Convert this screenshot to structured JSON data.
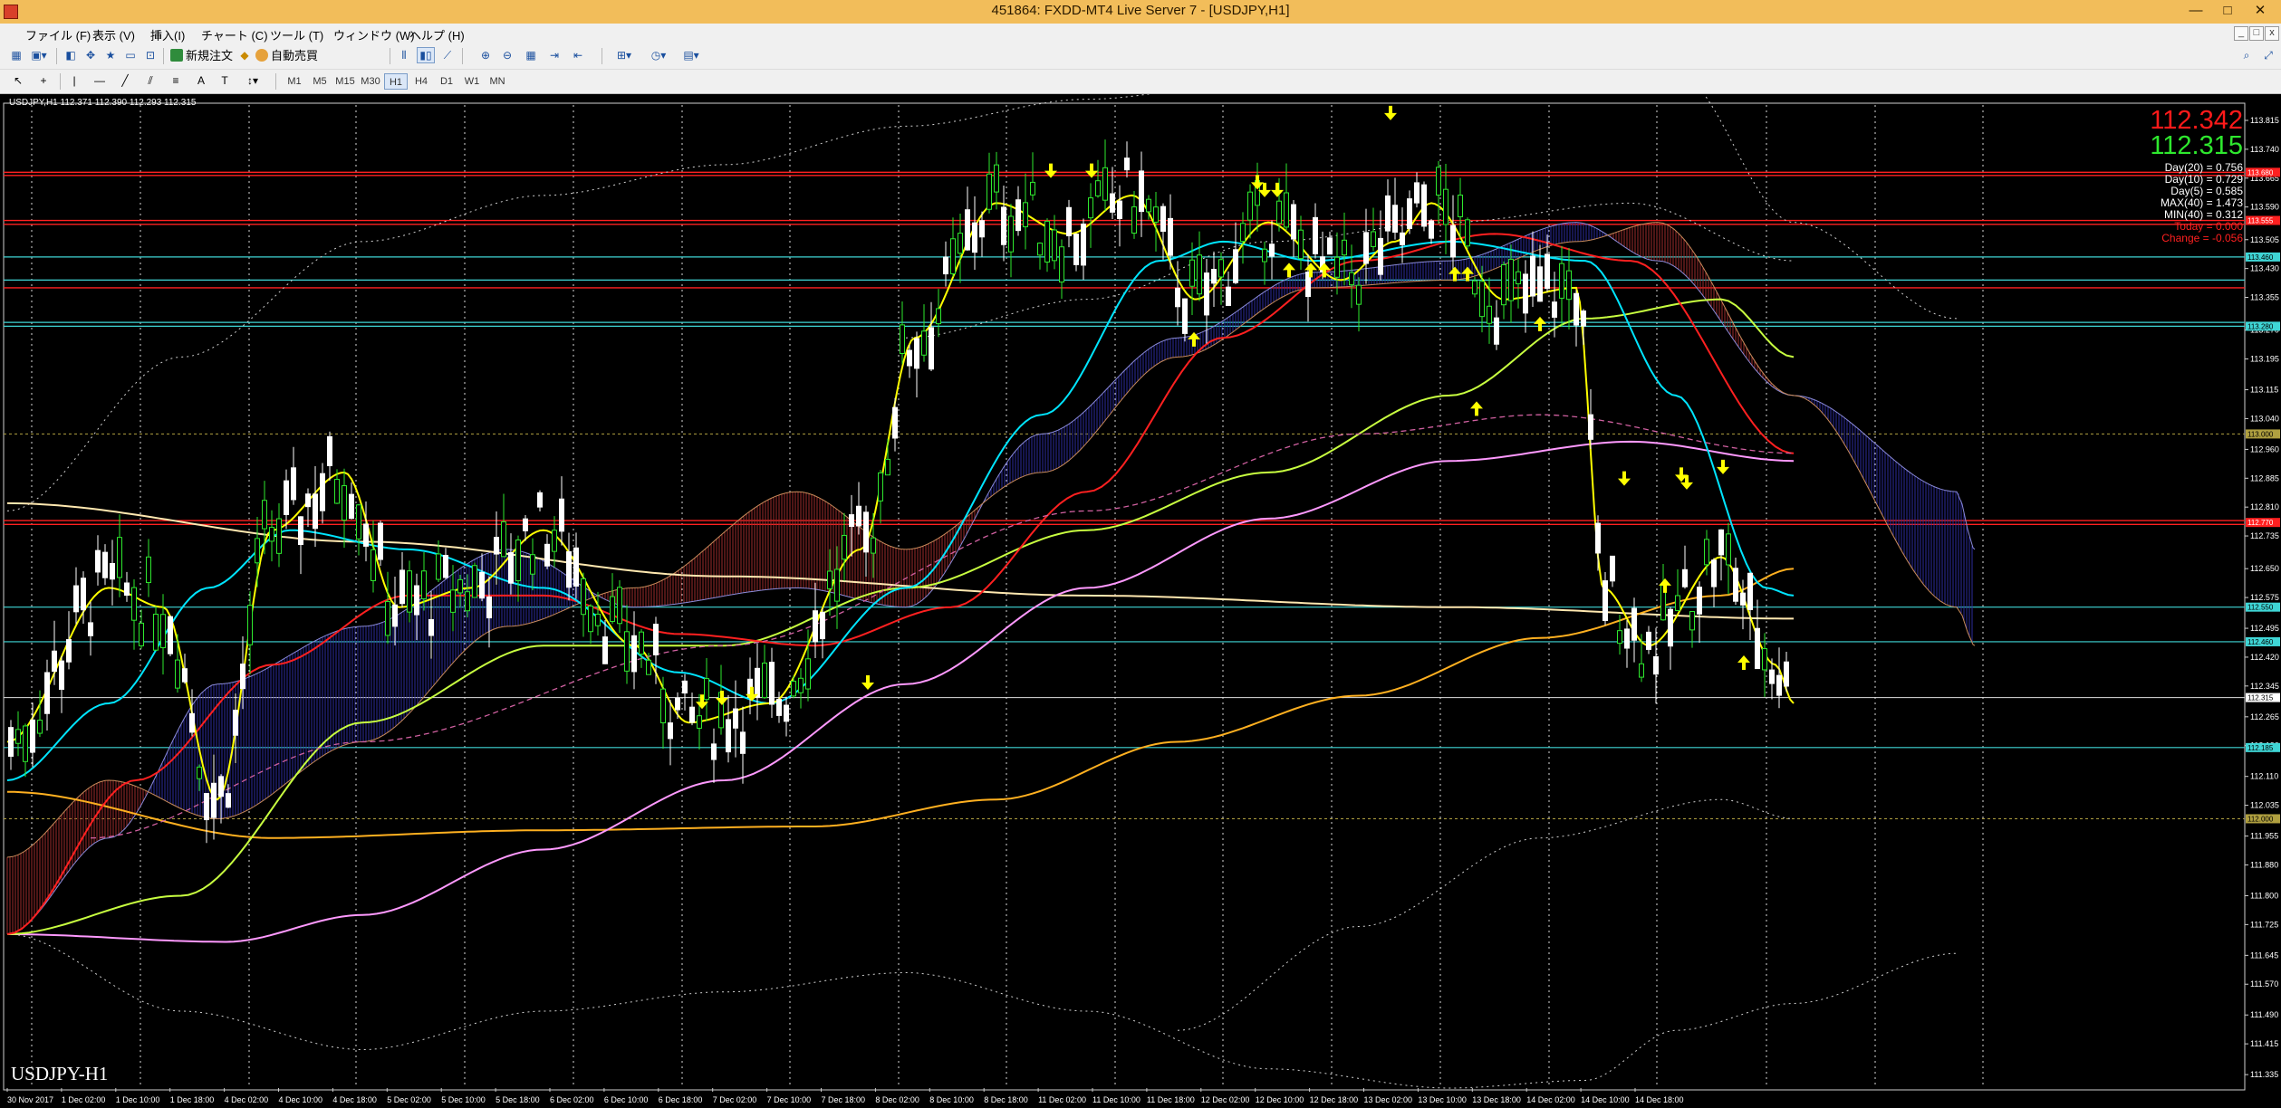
{
  "window": {
    "title": "451864: FXDD-MT4 Live Server 7 - [USDJPY,H1]",
    "controls": [
      "—",
      "□",
      "✕"
    ]
  },
  "menu": {
    "items": [
      "ファイル (F)",
      "表示 (V)",
      "挿入(I)",
      "チャート (C)",
      "ツール (T)",
      "ウィンドウ (W)",
      "ヘルプ (H)"
    ],
    "mdi_controls": [
      "_",
      "□",
      "x"
    ]
  },
  "toolbar": {
    "new_order_label": "新規注文",
    "auto_trade_label": "自動売買",
    "timeframes": [
      "M1",
      "M5",
      "M15",
      "M30",
      "H1",
      "H4",
      "D1",
      "W1",
      "MN"
    ],
    "active_timeframe": "H1"
  },
  "chart": {
    "info_line": "USDJPY,H1  112.371 112.390 112.293 112.315",
    "symbol_label": "USDJPY-H1",
    "bid_price": "112.342",
    "ask_price": "112.315",
    "stats": {
      "day20": "Day(20) = 0.756",
      "day10": "Day(10) = 0.729",
      "day5": "Day(5) = 0.585",
      "max40": "MAX(40) = 1.473",
      "min40": "MIN(40) = 0.312",
      "today": "Today = 0.000",
      "change": "Change = -0.056"
    },
    "price_axis": [
      "113.815",
      "113.740",
      "113.665",
      "113.590",
      "113.505",
      "113.430",
      "113.355",
      "113.270",
      "113.195",
      "113.115",
      "113.040",
      "112.960",
      "112.885",
      "112.810",
      "112.735",
      "112.650",
      "112.575",
      "112.495",
      "112.420",
      "112.345",
      "112.265",
      "112.190",
      "112.110",
      "112.035",
      "111.955",
      "111.880",
      "111.800",
      "111.725",
      "111.645",
      "111.570",
      "111.490",
      "111.415",
      "111.335"
    ],
    "time_axis": [
      "30 Nov 2017",
      "1 Dec 02:00",
      "1 Dec 10:00",
      "1 Dec 18:00",
      "4 Dec 02:00",
      "4 Dec 10:00",
      "4 Dec 18:00",
      "5 Dec 02:00",
      "5 Dec 10:00",
      "5 Dec 18:00",
      "6 Dec 02:00",
      "6 Dec 10:00",
      "6 Dec 18:00",
      "7 Dec 02:00",
      "7 Dec 10:00",
      "7 Dec 18:00",
      "8 Dec 02:00",
      "8 Dec 10:00",
      "8 Dec 18:00",
      "11 Dec 02:00",
      "11 Dec 10:00",
      "11 Dec 18:00",
      "12 Dec 02:00",
      "12 Dec 10:00",
      "12 Dec 18:00",
      "13 Dec 02:00",
      "13 Dec 10:00",
      "13 Dec 18:00",
      "14 Dec 02:00",
      "14 Dec 10:00",
      "14 Dec 18:00"
    ],
    "colors": {
      "bull_candle": "#2ee82e",
      "bear_candle": "#ffffff",
      "resistance": "#ff2020",
      "support": "#3fd6d6",
      "arrow": "#ffff00",
      "ma_fast": "#ffff00",
      "ma_mid": "#00e5ff",
      "ma_slow": "#ff2020",
      "ma_long": "#c8ff40",
      "ma_200": "#ff99ff",
      "ma_trend": "#ffb020",
      "ma_flat": "#ffe8b0"
    }
  }
}
